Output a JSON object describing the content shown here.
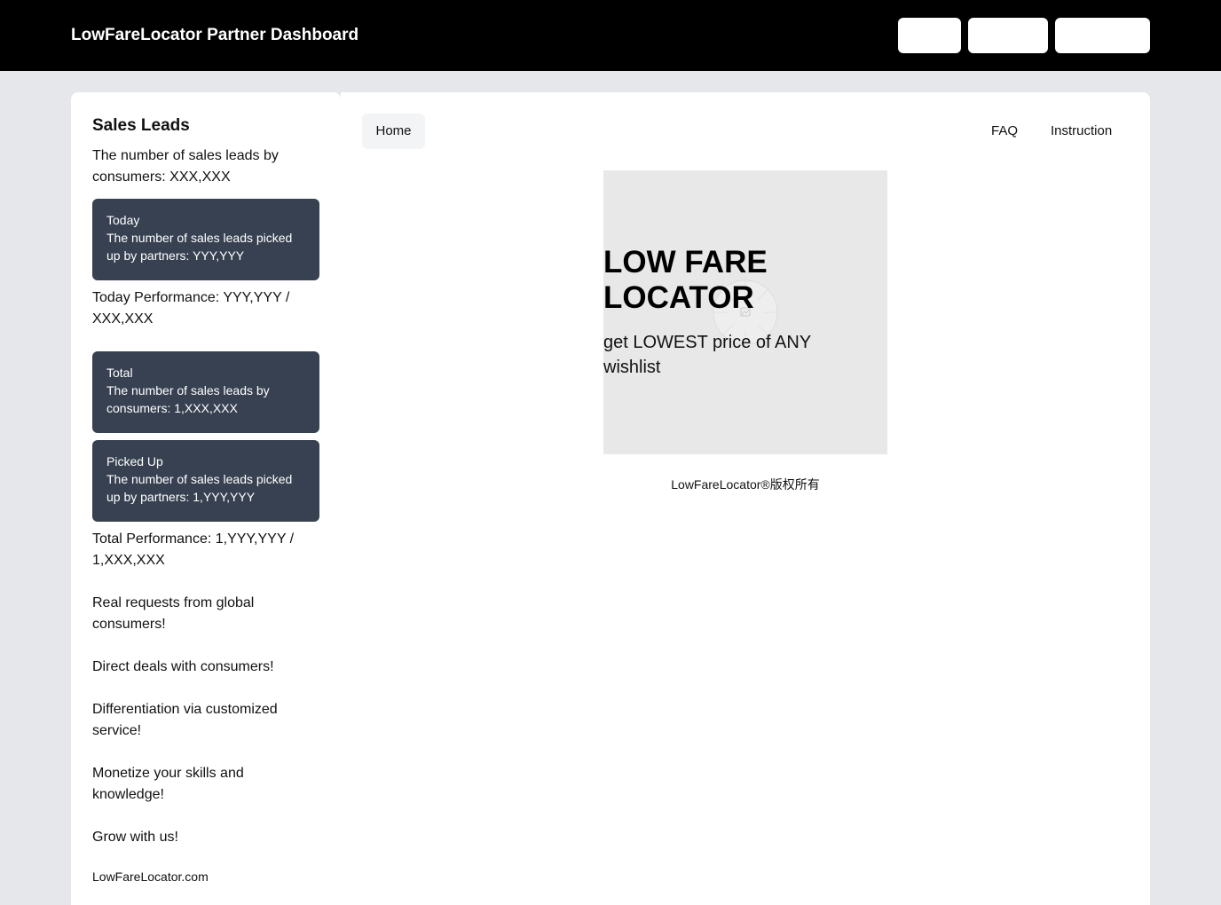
{
  "header": {
    "title": "LowFareLocator Partner Dashboard",
    "buttons": [
      "",
      "",
      ""
    ]
  },
  "sidebar": {
    "title": "Sales Leads",
    "leads_summary": "The number of sales leads by consumers: XXX,XXX",
    "today_card": {
      "label": "Today",
      "text": "The number of sales leads picked up by partners: YYY,YYY"
    },
    "today_performance": "Today Performance: YYY,YYY / XXX,XXX",
    "total_card": {
      "label": "Total",
      "text": "The number of sales leads by consumers: 1,XXX,XXX"
    },
    "picked_card": {
      "label": "Picked Up",
      "text": "The number of sales leads picked up by partners: 1,YYY,YYY"
    },
    "total_performance": "Total Performance: 1,YYY,YYY / 1,XXX,XXX",
    "slogans": [
      "Real requests from global consumers!",
      "Direct deals with consumers!",
      "Differentiation via customized service!",
      "Monetize your skills and knowledge!",
      "Grow with us!"
    ],
    "footer": "LowFareLocator.com"
  },
  "main": {
    "nav": {
      "home": "Home",
      "faq": "FAQ",
      "instruction": "Instruction"
    },
    "hero": {
      "headline": "LOW FARE LOCATOR",
      "tagline": "get LOWEST price of ANY wishlist",
      "icon": "image-placeholder-icon"
    },
    "copyright": "LowFareLocator®版权所有"
  },
  "colors": {
    "topbar": "#000000",
    "page_bg": "#e5e7eb",
    "card_bg": "#374151",
    "hero_bg": "#e8e8e8"
  }
}
